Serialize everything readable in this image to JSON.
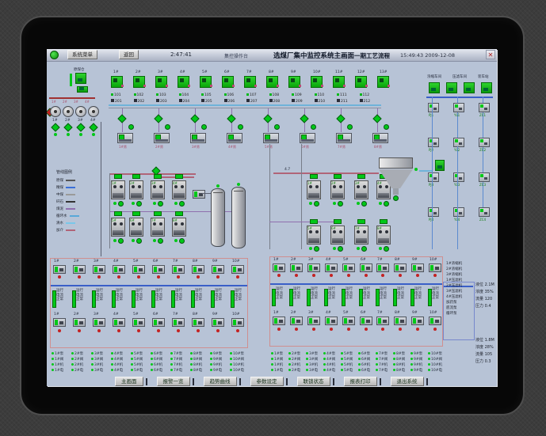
{
  "titlebar": {
    "menu_button": "系统菜单",
    "back_button": "返回",
    "time_left": "2:47:41",
    "operator_label": "集控操作台",
    "title": "选煤厂集中监控系统主画面",
    "title_suffix": "一期工艺流程",
    "datetime_right": "15:49:43  2009-12-08",
    "close_glyph": "✕"
  },
  "bunker": {
    "label": "原煤仓",
    "bins": [
      "1#",
      "2#",
      "3#",
      "4#"
    ],
    "agitators": [
      "1#",
      "2#",
      "3#",
      "4#"
    ]
  },
  "feeders": [
    "1#",
    "2#",
    "3#",
    "4#",
    "5#",
    "6#",
    "7#",
    "8#",
    "9#",
    "10#",
    "11#",
    "12#",
    "13#"
  ],
  "belts_upper": [
    "101",
    "102",
    "103",
    "104",
    "105",
    "106",
    "107",
    "108",
    "109",
    "110",
    "111",
    "112"
  ],
  "belts_lower": [
    "201",
    "202",
    "203",
    "204",
    "205",
    "206",
    "207",
    "208",
    "209",
    "210",
    "211",
    "212"
  ],
  "screens": [
    "1#筛",
    "2#筛",
    "3#筛",
    "4#筛",
    "5#筛",
    "6#筛",
    "7#筛",
    "8#筛"
  ],
  "right_top": {
    "headers": [
      "浓缩车间",
      "压滤车间",
      "装车站"
    ],
    "columns": [
      [
        "PJ1",
        "PJ2",
        "PJ3",
        "PJ4"
      ],
      [
        "YL1",
        "YL2",
        "YL3",
        "YL4"
      ],
      [
        "ZC1",
        "ZC2",
        "ZC3",
        "ZC4"
      ]
    ]
  },
  "legend": {
    "title": "管线图例",
    "items": [
      {
        "label": "原煤",
        "color": "#555555"
      },
      {
        "label": "精煤",
        "color": "#3a6fd8"
      },
      {
        "label": "中煤",
        "color": "#9a9a9a"
      },
      {
        "label": "矸石",
        "color": "#333333"
      },
      {
        "label": "煤泥",
        "color": "#8f6fae"
      },
      {
        "label": "循环水",
        "color": "#58a8d8"
      },
      {
        "label": "清水",
        "color": "#79c7ea"
      },
      {
        "label": "加介",
        "color": "#b06478"
      }
    ]
  },
  "groupA": {
    "top": [
      "1#",
      "2#",
      "3#",
      "4#"
    ],
    "bottom": [
      "5#",
      "6#",
      "7#",
      "8#"
    ]
  },
  "groupB": {
    "top": [
      "1#",
      "2#",
      "3#",
      "4#"
    ],
    "bottom": [
      "5#",
      "6#",
      "7#",
      "8#"
    ],
    "pipe_label": "4.7"
  },
  "panels": {
    "tags": [
      "1#",
      "2#",
      "3#",
      "4#",
      "5#",
      "6#",
      "7#",
      "8#",
      "9#",
      "10#"
    ],
    "cell_lines": [
      "运行",
      "电流",
      "正常"
    ]
  },
  "list_types": [
    "泵",
    "阀",
    "机",
    "电"
  ],
  "right_bottom": {
    "list": [
      "1#浓缩机",
      "2#浓缩机",
      "3#浓缩机",
      "1#压滤机",
      "2#压滤机",
      "3#压滤机",
      "4#压滤机",
      "加药泵",
      "底流泵",
      "循环泵"
    ],
    "group1": [
      "液位 2.1M",
      "浓度 35%",
      "流量 120",
      "压力 0.4"
    ],
    "group2": [
      "液位 1.8M",
      "浓度 28%",
      "流量 105",
      "压力 0.3"
    ]
  },
  "footer_buttons": [
    "主画面",
    "报警一览",
    "趋势曲线",
    "参数设定",
    "联锁状态",
    "报表打印",
    "退出系统"
  ],
  "colors": {
    "run_green": "#00c818",
    "alarm_red": "#c42222",
    "pipe_pink": "#b06478",
    "pipe_blue": "#3a5fc8",
    "pipe_cyan": "#6fb3d9",
    "pipe_purple": "#8f6fae",
    "panel_border": "#cf8f8f",
    "screen_bg": "#b7c3d6"
  }
}
